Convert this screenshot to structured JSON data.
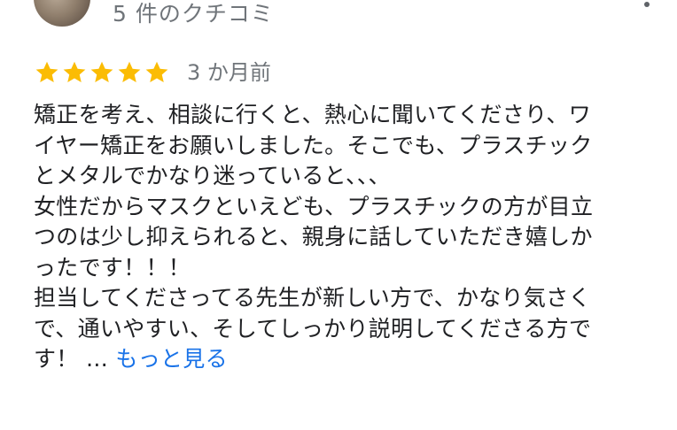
{
  "header": {
    "review_count": "5 件のクチコミ"
  },
  "rating": {
    "stars": 5,
    "max_stars": 5,
    "star_color": "#fbbc04",
    "relative_time": "3 か月前"
  },
  "review": {
    "lines": [
      "矯正を考え、相談に行くと、熱心に聞いてくださり、ワ",
      "イヤー矯正をお願いしました。そこでも、プラスチック",
      "とメタルでかなり迷っていると、、、",
      "女性だからマスクといえども、プラスチックの方が目立",
      "つのは少し抑えられると、親身に話していただき嬉しか",
      "ったです！！！",
      "担当してくださってる先生が新しい方で、かなり気さく",
      "で、通いやすい、そしてしっかり説明してくださる方で",
      "す！"
    ],
    "ellipsis": " … ",
    "more_label": "もっと見る"
  },
  "colors": {
    "text": "#202124",
    "secondary_text": "#70757a",
    "link": "#1a73e8"
  },
  "icons": {
    "star": "star-icon",
    "menu": "more-vert-icon"
  }
}
